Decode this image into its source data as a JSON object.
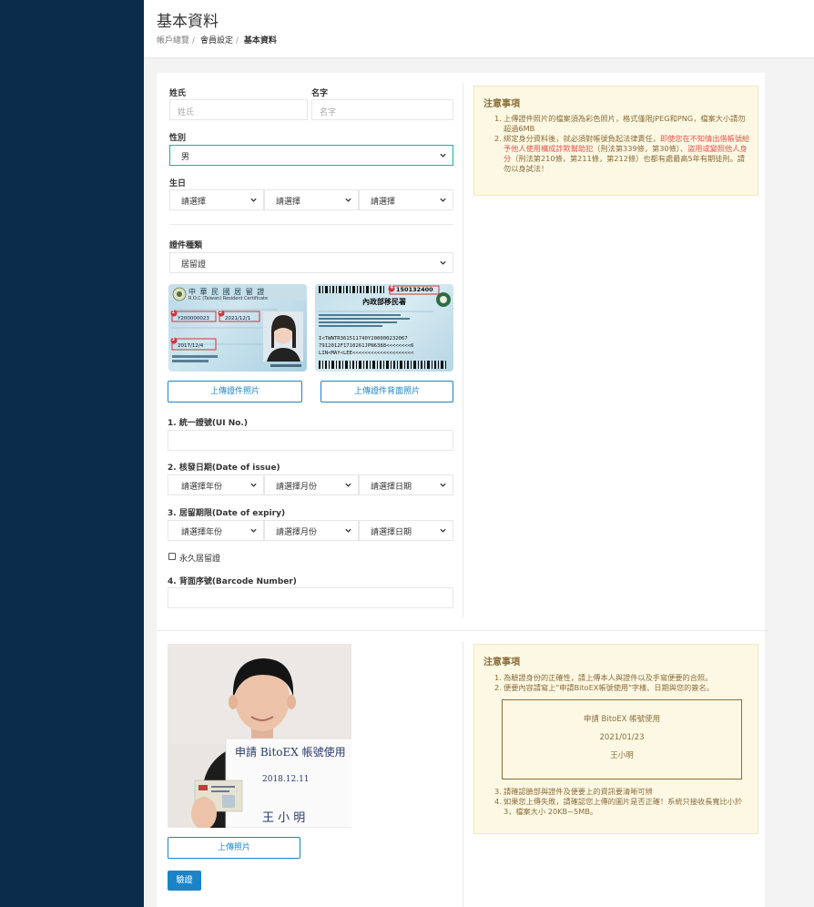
{
  "header": {
    "title": "基本資料",
    "breadcrumb": [
      "帳戶總覽",
      "會員設定",
      "基本資料"
    ]
  },
  "form": {
    "surname_label": "姓氏",
    "surname_placeholder": "姓氏",
    "name_label": "名字",
    "name_placeholder": "名字",
    "gender_label": "性別",
    "gender_value": "男",
    "birthday_label": "生日",
    "birthday_selects": [
      "請選擇",
      "請選擇",
      "請選擇"
    ],
    "id_type_label": "證件種類",
    "id_type_value": "居留證",
    "upload_front_label": "上傳證件照片",
    "upload_back_label": "上傳證件背面照片",
    "ui_no_label": "1. 統一證號(UI No.)",
    "issue_date_label": "2. 核發日期(Date of issue)",
    "issue_selects": [
      "請選擇年份",
      "請選擇月份",
      "請選擇日期"
    ],
    "expiry_date_label": "3. 居留期限(Date of expiry)",
    "expiry_selects": [
      "請選擇年份",
      "請選擇月份",
      "請選擇日期"
    ],
    "permanent_label": "永久居留證",
    "barcode_label": "4. 背面序號(Barcode Number)"
  },
  "id_front": {
    "header_text": "中 華 民 國 居 留 證",
    "sub_text": "R.O.C (Taiwan) Resident Certificate",
    "markers": [
      "1",
      "2",
      "3"
    ],
    "fields": [
      "Y200000023",
      "2021/12/1",
      "2017/12/4"
    ]
  },
  "id_back": {
    "barcode_number": "150132400",
    "marker": "4",
    "agency": "內政部移民署",
    "mrz": [
      "I<TWNTR361511740Y200000232067",
      "7912012F1710261JPN6388<<<<<<<<6",
      "LIN<MAY<LEE<<<<<<<<<<<<<<<<<<<<"
    ]
  },
  "notice1": {
    "title": "注意事項",
    "items": [
      {
        "num": "1.",
        "text": "上傳證件照片的檔案須為彩色照片，格式僅限JPEG和PNG，檔案大小請勿超過6MB"
      },
      {
        "num": "2.",
        "text_before": "綁定身分資料後，就必須對帳號負起法律責任，",
        "text_red": "即使您在不知情出借帳號給予他人使用構成詐欺幫助犯",
        "text_mid": "（刑法第339條，第30條）、",
        "text_red2": "盜用或變照他人身分",
        "text_after": "（刑法第210條，第211條，第212條）也都有處最高5年有期徒刑。請勿以身試法！"
      }
    ]
  },
  "selfie": {
    "sign_line1": "申請 BitoEX 帳號使用",
    "sign_date": "2018.12.11",
    "sign_name": "王 小 明",
    "upload_label": "上傳照片",
    "verify_label": "驗證"
  },
  "notice2": {
    "title": "注意事項",
    "items": [
      {
        "num": "1.",
        "text": "為驗證身份的正確性，請上傳本人與證件以及手寫便要的合照。"
      },
      {
        "num": "2.",
        "text": "便要內容請寫上\"申請BitoEX帳號使用\"字樣、日期與您的簽名。"
      }
    ],
    "example": [
      "申請 BitoEX 帳號使用",
      "2021/01/23",
      "王小明"
    ],
    "items2": [
      {
        "num": "3.",
        "text": "請確認臉部與證件及便要上的資訊要清晰可辨"
      },
      {
        "num": "4.",
        "text": "如果您上傳失敗，請確認您上傳的圖片是否正確！系統只接收長寬比小於3，檔案大小 20KB~5MB。"
      }
    ]
  },
  "colors": {
    "sidebar": "#0b2d4b",
    "accent": "#1c84c6",
    "notice_bg": "#fcf8e3",
    "notice_text": "#8a6d3b",
    "warning_red": "#e8554e"
  }
}
